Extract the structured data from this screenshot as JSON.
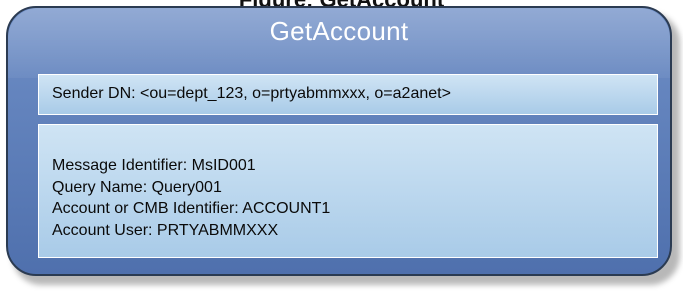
{
  "figure": {
    "caption": "Figure: GetAccount"
  },
  "card": {
    "title": "GetAccount",
    "sender_dn": "Sender DN: <ou=dept_123, o=prtyabmmxxx, o=a2anet>",
    "fields": [
      "Message Identifier: MsID001",
      "Query Name: Query001",
      "Account or CMB Identifier: ACCOUNT1",
      "Account User: PRTYABMMXXX"
    ]
  },
  "colors": {
    "card_fill": "#5b7dba",
    "card_border": "#2b3b52",
    "panel_fill": "#bcd8ee",
    "title_text": "#ffffff"
  }
}
